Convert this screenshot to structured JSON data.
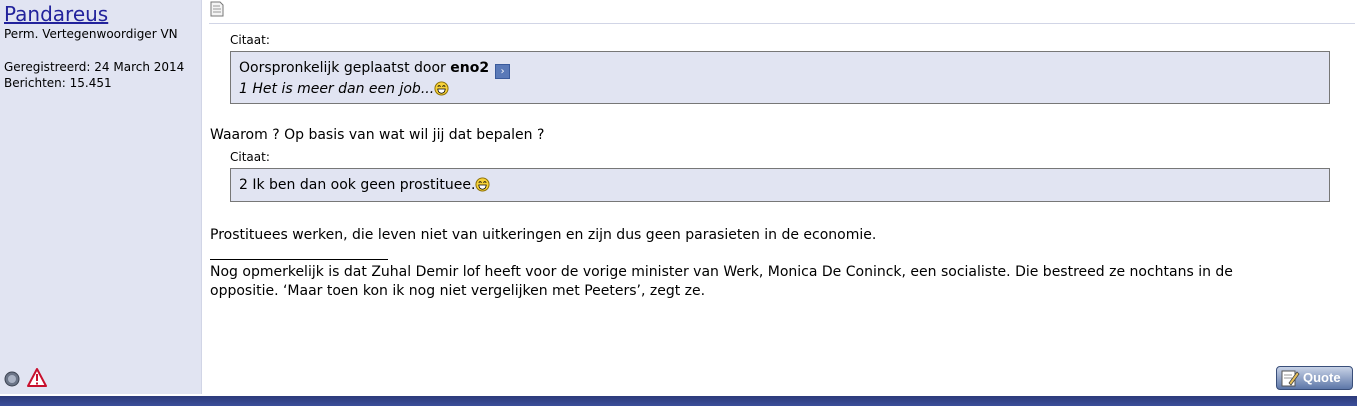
{
  "user": {
    "name": "Pandareus",
    "title": "Perm. Vertegenwoordiger VN",
    "registered": "Geregistreerd: 24 March 2014",
    "posts": "Berichten: 15.451"
  },
  "post": {
    "quote1": {
      "label": "Citaat:",
      "prefix": "Oorspronkelijk geplaatst door",
      "author": "eno2",
      "text": "1 Het is meer dan een job..."
    },
    "reply1": "Waarom ? Op basis van wat wil jij dat bepalen ?",
    "quote2": {
      "label": "Citaat:",
      "text": "2 Ik ben dan ook geen prostituee."
    },
    "reply2": "Prostituees werken, die leven niet van uitkeringen en zijn dus geen parasieten in de economie.",
    "signature": {
      "line1": "Nog opmerkelijk is dat Zuhal Demir lof heeft voor de vorige minister van Werk, Monica De Coninck, een socialiste. Die bestreed ze nochtans in de",
      "line2": "oppositie. ‘Maar toen kon ik nog niet vergelijken met Peeters’, zegt ze."
    },
    "quote_button": "Quote"
  },
  "colors": {
    "sidebar_bg": "#E1E4F2",
    "quote_bg": "#E1E4F2",
    "username": "#22229C",
    "footer": "#2C3A7A"
  },
  "icons": {
    "post": "document-icon",
    "view_post": "arrow-right-icon",
    "smiley": "laughing-smiley-icon",
    "status": "offline-status-icon",
    "report": "warning-icon",
    "quote": "pen-icon"
  }
}
